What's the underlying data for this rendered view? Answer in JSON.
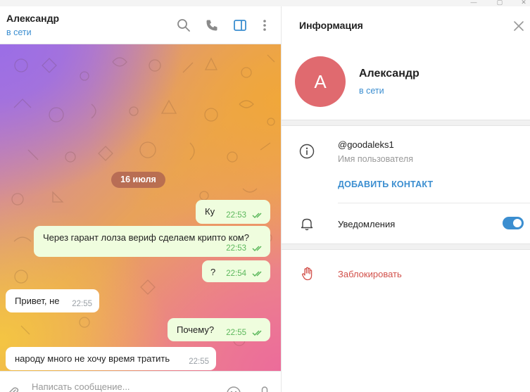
{
  "window": {
    "minimize_glyph": "—",
    "maximize_glyph": "▢",
    "close_glyph": "✕"
  },
  "chat": {
    "contact_name": "Александр",
    "status": "в сети",
    "header_icons": [
      "search-icon",
      "phone-icon",
      "sidebar-toggle-icon",
      "more-vert-icon"
    ],
    "date_label": "16 июля",
    "messages": [
      {
        "direction": "out",
        "text": "Ку",
        "time": "22:53",
        "read": true
      },
      {
        "direction": "out",
        "text": "Через гарант лолза вериф сделаем крипто ком?",
        "time": "22:53",
        "read": true
      },
      {
        "direction": "out",
        "text": "?",
        "time": "22:54",
        "read": true
      },
      {
        "direction": "in",
        "text": "Привет, не",
        "time": "22:55"
      },
      {
        "direction": "out",
        "text": "Почему?",
        "time": "22:55",
        "read": true
      },
      {
        "direction": "in",
        "text": "народу много не хочу время тратить",
        "time": "22:55"
      }
    ],
    "composer": {
      "placeholder": "Написать сообщение..."
    }
  },
  "info_panel": {
    "title": "Информация",
    "avatar_letter": "А",
    "name": "Александр",
    "status": "в сети",
    "username": "@goodaleks1",
    "username_caption": "Имя пользователя",
    "add_contact_label": "ДОБАВИТЬ КОНТАКТ",
    "notifications_label": "Уведомления",
    "notifications_on": true,
    "block_label": "Заблокировать"
  },
  "colors": {
    "accent": "#3b8ed0",
    "avatar": "#e06a6f",
    "outgoing_bubble": "#effdde",
    "block_red": "#d2504a"
  }
}
